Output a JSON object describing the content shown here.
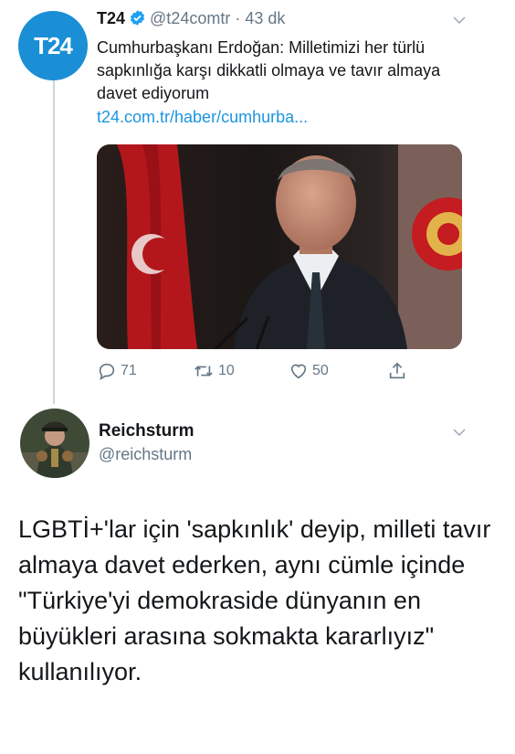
{
  "tweet_original": {
    "avatar_text": "T24",
    "name": "T24",
    "handle": "@t24comtr",
    "separator": "·",
    "time": "43 dk",
    "text": "Cumhurbaşkanı Erdoğan: Milletimizi her türlü sapkınlığa karşı dikkatli olmaya ve tavır almaya davet ediyorum",
    "link": "t24.com.tr/haber/cumhurba...",
    "replies": "71",
    "retweets": "10",
    "likes": "50"
  },
  "tweet_reply": {
    "name": "Reichsturm",
    "handle": "@reichsturm",
    "text": "LGBTİ+'lar için 'sapkınlık' deyip, milleti tavır almaya davet ederken, aynı cümle içinde \"Türkiye'yi demokraside dünyanın en büyükleri arasına sokmakta kararlıyız\" kullanılıyor."
  },
  "colors": {
    "accent": "#1b95e0",
    "t24_avatar": "#1a8fd6",
    "secondary_text": "#657786",
    "thread_line": "#ccd6dd"
  },
  "icons": [
    "verified-icon",
    "chevron-down-icon",
    "reply-icon",
    "retweet-icon",
    "like-icon",
    "share-icon"
  ]
}
